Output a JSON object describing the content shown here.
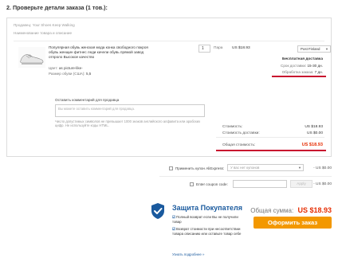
{
  "heading": "2. Проверьте детали заказа (1 тов.):",
  "seller": "Продавец: Your Shoes Keep Walking",
  "product_header": "Наименование товара и описание",
  "product": {
    "title": "Популярная обувь женская мода конка свободного покроя обувь женщин фитнес леди качели обувь прямой завод отпроло Высокое качество",
    "attrs": [
      {
        "label": "Цвет:",
        "value": "as picture-like-"
      },
      {
        "label": "Размер обуви (США):",
        "value": "5,5"
      }
    ],
    "quantity": "1",
    "qty_unit": "Пара",
    "unit_price": "US $18.93"
  },
  "shipping": {
    "method": "Post Finland",
    "free": "Бесплатная доставка",
    "delivery_label": "Срок доставки:",
    "delivery_value": "15-30 дн.",
    "processing_label": "Обработка заказа:",
    "processing_value": "7 дн."
  },
  "comment": {
    "label": "Оставить комментарий для продавца",
    "placeholder": "Вы можете оставить комментарий для продавца.",
    "hint": "Число допустимых символов не превышает 1000 знаков английского алфавита или арабских цифр. Не используйте коды HTML."
  },
  "totals": {
    "cost_label": "Стоимость:",
    "cost": "US $18.93",
    "shipping_label": "Стоимость доставки:",
    "shipping": "US $0.00",
    "total_label": "Общая стоимость:",
    "total": "US $18.93"
  },
  "coupons": {
    "ae_label": "Применить купон AliExpress:",
    "ae_placeholder": "У вас нет купонов",
    "ae_value": "- US $0.00",
    "code_label": "Enter coupon code:",
    "apply_label": "Apply",
    "code_value": "- US $0.00"
  },
  "buyer_protection": {
    "title": "Защита Покупателя",
    "items": [
      "Полный возврат если Вы не получили товар",
      "Возврат стоимости при несоответствии товара описанию или оставьте товар себе"
    ],
    "more": "Узнать подробнее »"
  },
  "summary": {
    "total_label": "Общая сумма:",
    "total_value": "US $18.93",
    "place_order": "Оформить заказ"
  },
  "colors": {
    "accent_red": "#c8102e",
    "price_red": "#e62e04",
    "order_button": "#f39800",
    "protection_blue": "#1a5a9e"
  }
}
